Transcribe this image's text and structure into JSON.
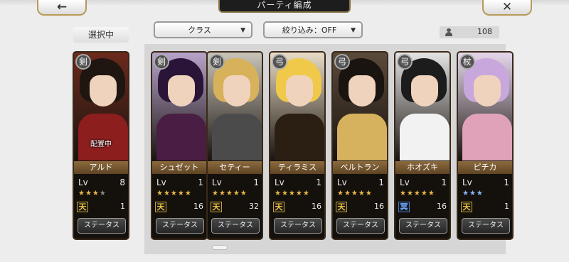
{
  "header": {
    "title": "パーティ編成",
    "back_icon": "←",
    "close_icon": "✕"
  },
  "selected_tab": "選択中",
  "filters": {
    "class_label": "クラス",
    "filter_label": "絞り込み：OFF",
    "arrow": "▼"
  },
  "unit_count": "108",
  "status_label": "ステータス",
  "cards": [
    {
      "name": "アルド",
      "lv_label": "Lv",
      "level": "8",
      "stars": "★★★",
      "star_extra": "★",
      "tier": "1",
      "tier_icon": "天",
      "badge": "剣",
      "deploy": "配置中",
      "colors": {
        "bg": "#6b2a1c",
        "hair": "#1f1612",
        "body": "#8c1e1e"
      }
    },
    {
      "name": "シュゼット",
      "lv_label": "Lv",
      "level": "1",
      "stars": "★★★★★",
      "tier": "16",
      "tier_icon": "天",
      "badge": "剣",
      "colors": {
        "bg": "#b7a3c9",
        "hair": "#2a1538",
        "body": "#4a1d44"
      }
    },
    {
      "name": "セティー",
      "lv_label": "Lv",
      "level": "1",
      "stars": "★★★★★",
      "tier": "32",
      "tier_icon": "天",
      "badge": "剣",
      "colors": {
        "bg": "#c9c4b8",
        "hair": "#d8b25a",
        "body": "#4b4b4b"
      }
    },
    {
      "name": "ティラミス",
      "lv_label": "Lv",
      "level": "1",
      "stars": "★★★★★",
      "tier": "16",
      "tier_icon": "天",
      "badge": "弓",
      "colors": {
        "bg": "#e8dcc6",
        "hair": "#f0c94a",
        "body": "#2b1f14"
      }
    },
    {
      "name": "ベルトラン",
      "lv_label": "Lv",
      "level": "1",
      "stars": "★★★★★",
      "tier": "16",
      "tier_icon": "天",
      "badge": "弓",
      "colors": {
        "bg": "#5a4a3a",
        "hair": "#1a1410",
        "body": "#d7b25e"
      }
    },
    {
      "name": "ホオズキ",
      "lv_label": "Lv",
      "level": "1",
      "stars": "★★★★★",
      "tier": "16",
      "tier_icon": "冥",
      "badge": "弓",
      "colors": {
        "bg": "#e4e4e4",
        "hair": "#1c1c1c",
        "body": "#f2f2f2"
      }
    },
    {
      "name": "ピチカ",
      "lv_label": "Lv",
      "level": "1",
      "stars": "★★★",
      "tier": "1",
      "tier_icon": "天",
      "badge": "杖",
      "colors": {
        "bg": "#e6d8ea",
        "hair": "#c8a8dc",
        "body": "#e0a2b8"
      }
    }
  ]
}
